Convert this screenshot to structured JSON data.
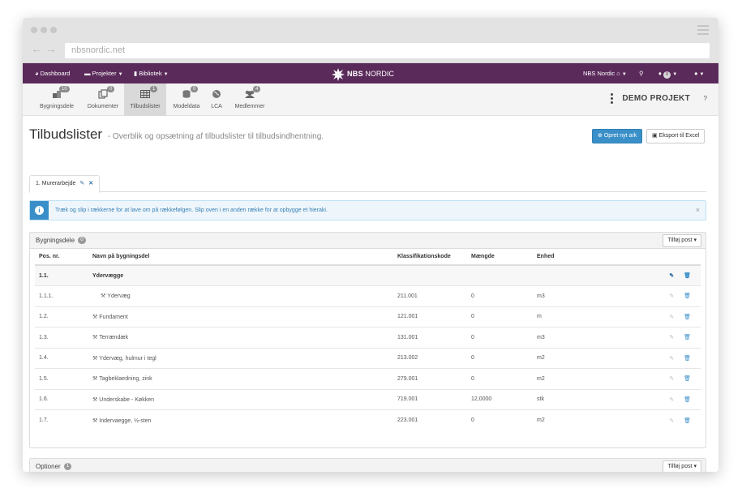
{
  "browser": {
    "url": "nbsnordic.net"
  },
  "topnav": {
    "left": [
      {
        "label": "Dashboard",
        "icon": "dashboard-icon"
      },
      {
        "label": "Projekter",
        "icon": "folder-icon"
      },
      {
        "label": "Bibliotek",
        "icon": "book-icon"
      }
    ],
    "logo_bold": "NBS",
    "logo_rest": "NORDIC",
    "user_menu": "NBS Nordic",
    "notifications_count": "0"
  },
  "subnav": {
    "tabs": [
      {
        "label": "Bygningsdele",
        "count": "10",
        "icon": "building-parts-icon"
      },
      {
        "label": "Dokumenter",
        "count": "0",
        "icon": "documents-icon"
      },
      {
        "label": "Tilbudslister",
        "count": "1",
        "icon": "table-icon"
      },
      {
        "label": "Modeldata",
        "count": "0",
        "icon": "database-icon"
      },
      {
        "label": "LCA",
        "count": "",
        "icon": "globe-icon"
      },
      {
        "label": "Medlemmer",
        "count": "4",
        "icon": "users-icon"
      }
    ],
    "active_index": 2,
    "project_name": "DEMO PROJEKT",
    "help": "?"
  },
  "page": {
    "title": "Tilbudslister",
    "subtitle": "- Overblik og opsætning af tilbudslister til tilbudsindhentning.",
    "new_sheet_button": "Opret nyt ark",
    "export_button": "Eksport til Excel",
    "tab_label": "1. Murerarbejde"
  },
  "alert": {
    "message": "Træk og slip i rækkerne for at lave om på rækkefølgen. Slip oven i en anden række for at opbygge et hieraki.",
    "close": "×"
  },
  "panel_parts": {
    "title": "Bygningsdele",
    "count": "0",
    "add_button": "Tilføj post",
    "columns": [
      "Pos. nr.",
      "Navn på bygningsdel",
      "Klassifikationskode",
      "Mængde",
      "Enhed"
    ],
    "rows": [
      {
        "pos": "1.1.",
        "name": "Ydervægge",
        "code": "",
        "qty": "",
        "unit": "",
        "group": true
      },
      {
        "pos": "1.1.1.",
        "name": "Ydervæg",
        "code": "211.001",
        "qty": "0",
        "unit": "m3",
        "indent": true
      },
      {
        "pos": "1.2.",
        "name": "Fundament",
        "code": "121.001",
        "qty": "0",
        "unit": "m"
      },
      {
        "pos": "1.3.",
        "name": "Terrændæk",
        "code": "131.001",
        "qty": "0",
        "unit": "m3"
      },
      {
        "pos": "1.4.",
        "name": "Ydervæg, hulmur i tegl",
        "code": "213.002",
        "qty": "0",
        "unit": "m2"
      },
      {
        "pos": "1.5.",
        "name": "Tagbeklaedning, zink",
        "code": "279.001",
        "qty": "0",
        "unit": "m2"
      },
      {
        "pos": "1.6.",
        "name": "Underskabe - Køkken",
        "code": "719.001",
        "qty": "12,0000",
        "unit": "stk"
      },
      {
        "pos": "1.7.",
        "name": "Indervaegge, ½-sten",
        "code": "223.001",
        "qty": "0",
        "unit": "m2"
      }
    ]
  },
  "panel_options": {
    "title": "Optioner",
    "count": "1",
    "add_button": "Tilføj post"
  },
  "colors": {
    "nav": "#5a2a5a",
    "primary": "#3a8fc8"
  }
}
